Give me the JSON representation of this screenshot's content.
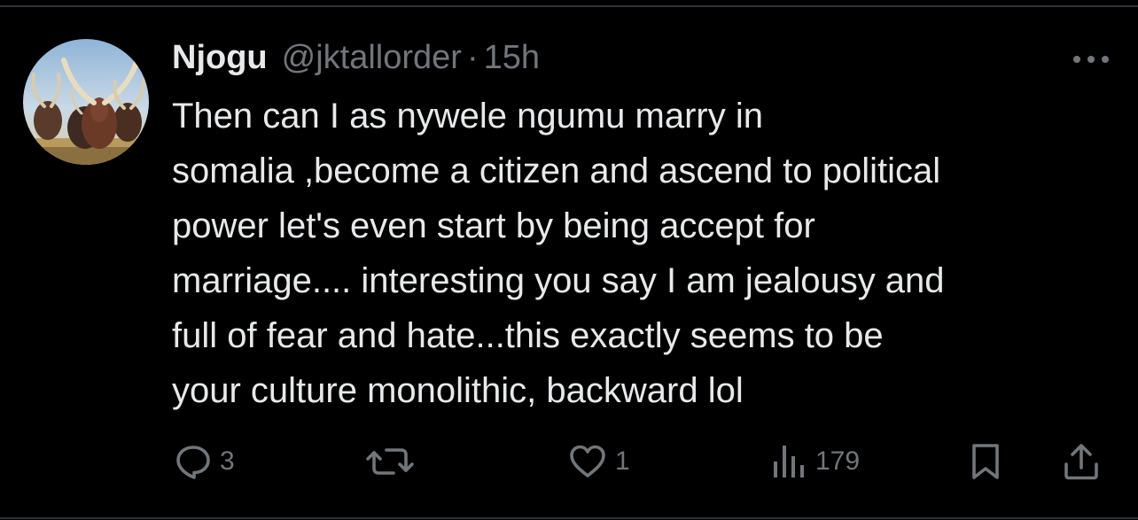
{
  "tweet": {
    "author": {
      "display_name": "Njogu",
      "handle": "@jktallorder",
      "avatar_icon": "cattle-herd-avatar"
    },
    "separator": "·",
    "timestamp": "15h",
    "text": "Then can I as nywele ngumu marry in\nsomalia ,become a citizen and ascend to political\npower let's even start by being accept for\nmarriage.... interesting you say I am jealousy and\nfull of fear and hate...this exactly seems to be\nyour culture monolithic, backward lol",
    "actions": {
      "reply_count": "3",
      "retweet_count": "",
      "like_count": "1",
      "views_count": "179"
    },
    "icons": {
      "more": "more-dots-icon",
      "reply": "reply-bubble-icon",
      "retweet": "retweet-arrows-icon",
      "like": "heart-icon",
      "views": "views-bars-icon",
      "bookmark": "bookmark-icon",
      "share": "share-upload-icon"
    },
    "colors": {
      "background": "#000000",
      "text": "#e7e9ea",
      "secondary": "#71767b",
      "border": "#2f3336"
    }
  }
}
